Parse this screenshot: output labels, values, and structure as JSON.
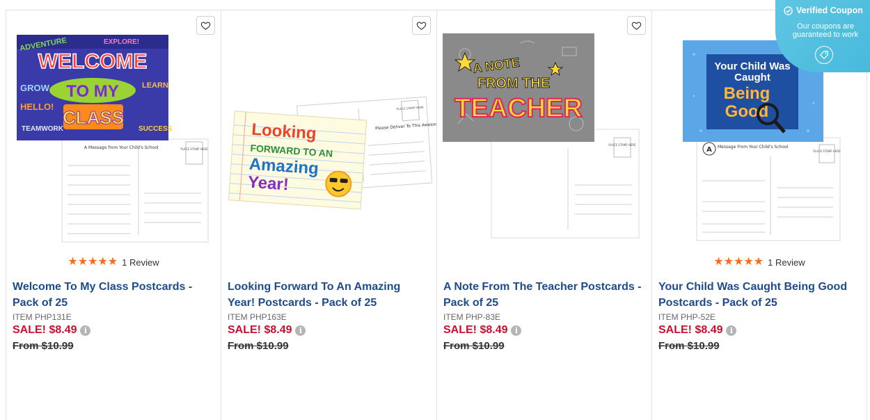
{
  "coupon": {
    "title": "Verified Coupon",
    "subtitle": "Our coupons are guaranteed to work"
  },
  "products": [
    {
      "image_text": {
        "line1": "WELCOME",
        "line2": "TO MY",
        "line3": "CLASS",
        "side_words": [
          "ADVENTURE",
          "EXPLORE!",
          "GROW",
          "LEARN",
          "HELLO!",
          "TEAMWORK",
          "SUCCESS"
        ],
        "back_text": "A Message from Your Child's School",
        "stamp": "PLACE STAMP HERE"
      },
      "stars": "★★★★★",
      "review_count": "1 Review",
      "title": "Welcome To My Class Postcards - Pack of 25",
      "item": "ITEM PHP131E",
      "sale": "SALE! $8.49",
      "from": "From $10.99"
    },
    {
      "image_text": {
        "line1": "Looking",
        "line2": "FORWARD TO AN",
        "line3": "Amazing",
        "line4": "Year!",
        "back_text": "Please Deliver To This Awesome Student!",
        "stamp": "PLACE STAMP HERE"
      },
      "stars": "",
      "review_count": "",
      "title": "Looking Forward To An Amazing Year! Postcards - Pack of 25",
      "item": "ITEM PHP163E",
      "sale": "SALE! $8.49",
      "from": "From $10.99"
    },
    {
      "image_text": {
        "line1": "A NOTE",
        "line2": "FROM THE",
        "line3": "TEACHER",
        "stamp": "PLACE STAMP HERE"
      },
      "stars": "",
      "review_count": "",
      "title": "A Note From The Teacher Postcards - Pack of 25",
      "item": "ITEM PHP-83E",
      "sale": "SALE! $8.49",
      "from": "From $10.99"
    },
    {
      "image_text": {
        "line1": "Your Child Was",
        "line2": "Caught",
        "line3": "Being",
        "line4": "Good",
        "back_text": "Message From Your Child's School",
        "stamp": "PLACE STAMP HERE"
      },
      "stars": "★★★★★",
      "review_count": "1 Review",
      "title": "Your Child Was Caught Being Good Postcards - Pack of 25",
      "item": "ITEM PHP-52E",
      "sale": "SALE! $8.49",
      "from": "From $10.99"
    }
  ],
  "colors": {
    "title_blue": "#1e4b8a",
    "sale_red": "#c8102e",
    "star_orange": "#f36f21",
    "coupon_blue": "#4bbbe0"
  }
}
